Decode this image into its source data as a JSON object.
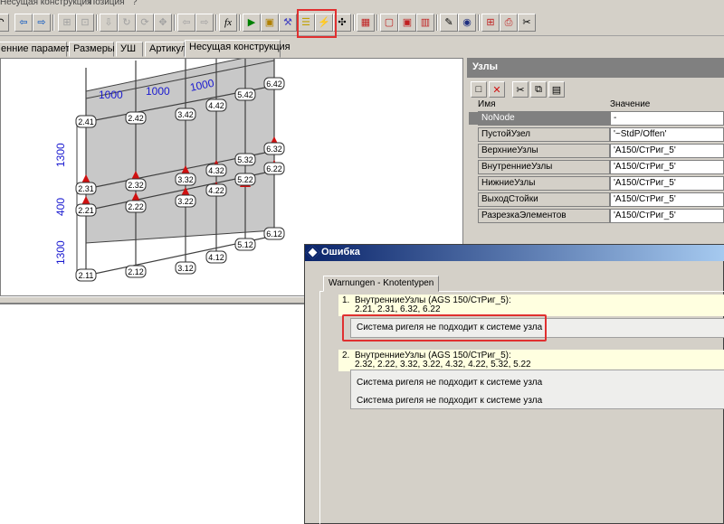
{
  "menu": [
    "Несущая конструкция",
    "Позиция",
    "?"
  ],
  "tabs": [
    "енние параметры",
    "Размеры",
    "УШ",
    "Артикул",
    "Несущая конструкция"
  ],
  "drawing": {
    "top_dims": [
      "1000",
      "1000",
      "1000"
    ],
    "left_dims": [
      "1300",
      "400",
      "1300"
    ],
    "nodes": [
      "2.41",
      "2.42",
      "3.42",
      "4.42",
      "5.42",
      "6.42",
      "2.31",
      "2.32",
      "3.32",
      "4.32",
      "5.32",
      "6.32",
      "2.21",
      "2.22",
      "3.22",
      "4.22",
      "5.22",
      "6.22",
      "2.11",
      "2.12",
      "3.12",
      "4.12",
      "5.12",
      "6.12"
    ]
  },
  "nodes_panel": {
    "title": "Узлы",
    "col_name": "Имя",
    "col_value": "Значение",
    "rows": [
      {
        "name": "NoNode",
        "value": "-"
      },
      {
        "name": "ПустойУзел",
        "value": "'~StdP/Offen'"
      },
      {
        "name": "ВерхниеУзлы",
        "value": "'A150/СтРиг_5'"
      },
      {
        "name": "ВнутренниеУзлы",
        "value": "'A150/СтРиг_5'"
      },
      {
        "name": "НижниеУзлы",
        "value": "'A150/СтРиг_5'"
      },
      {
        "name": "ВыходСтойки",
        "value": "'A150/СтРиг_5'"
      },
      {
        "name": "РазрезкаЭлементов",
        "value": "'A150/СтРиг_5'"
      }
    ]
  },
  "dialog": {
    "title": "Ошибка",
    "tab": "Warnungen - Knotentypen",
    "w1_num": "1.",
    "w1_head": "ВнутренниеУзлы (AGS 150/СтРиг_5):",
    "w1_nodes": "2.21, 2.31, 6.32, 6.22",
    "w1_msg": "Система ригеля не подходит к системе узла",
    "w2_num": "2.",
    "w2_head": "ВнутренниеУзлы (AGS 150/СтРиг_5):",
    "w2_nodes": "2.32, 2.22, 3.32, 3.22, 4.32, 4.22, 5.32, 5.22",
    "w2_msg1": "Система ригеля не подходит к системе узла",
    "w2_msg2": "Система ригеля не подходит к системе узла"
  }
}
